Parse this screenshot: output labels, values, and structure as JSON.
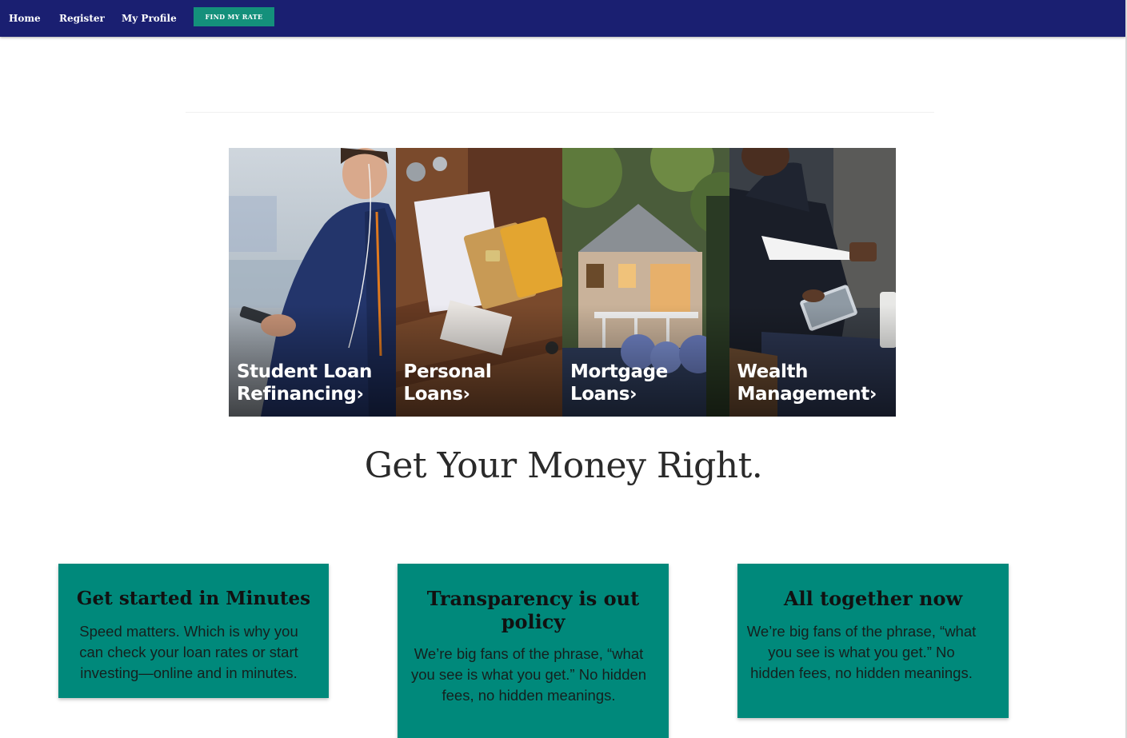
{
  "nav": {
    "home": "Home",
    "register": "Register",
    "profile": "My Profile",
    "cta": "FIND MY RATE"
  },
  "tiles": [
    {
      "label": "Student Loan\nRefinancing",
      "chevron": "›",
      "icon": "student-photo"
    },
    {
      "label": "Personal\nLoans",
      "chevron": "›",
      "icon": "wallet-photo"
    },
    {
      "label": "Mortgage\nLoans",
      "chevron": "›",
      "icon": "house-photo"
    },
    {
      "label": "Wealth\nManagement",
      "chevron": "›",
      "icon": "businessman-photo"
    }
  ],
  "headline": "Get Your Money Right.",
  "cards": [
    {
      "title": "Get started in Minutes",
      "text": "Speed matters. Which is why you can check your loan rates or start investing—online and in minutes."
    },
    {
      "title": "Transparency is out policy",
      "text": "We’re big fans of the phrase, “what you see is what you get.” No hidden fees, no hidden meanings."
    },
    {
      "title": "All together now",
      "text": "We’re big fans of the phrase, “what you see is what you get.” No hidden fees, no hidden meanings."
    }
  ],
  "colors": {
    "nav_bg": "#1a1f71",
    "cta_bg": "#14907b",
    "card_bg": "#00897b"
  }
}
